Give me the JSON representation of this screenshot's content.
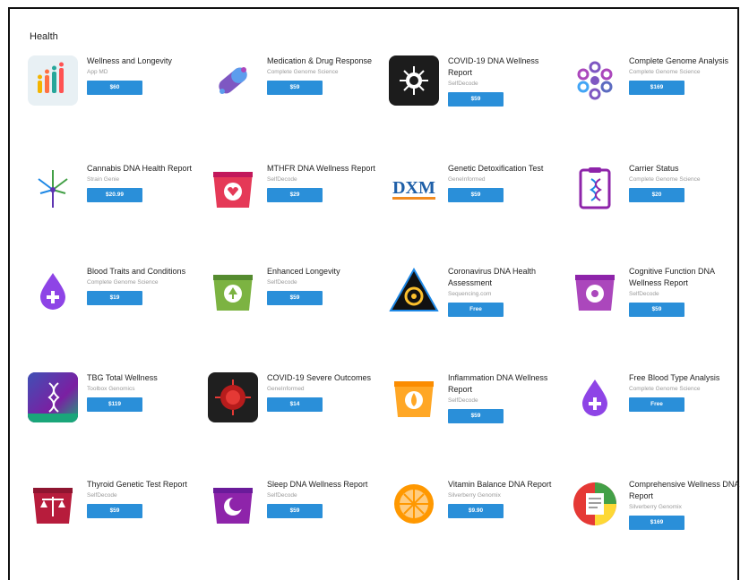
{
  "section": {
    "title": "Health"
  },
  "products": [
    {
      "name": "Wellness and Longevity",
      "vendor": "App MD",
      "price": "$60",
      "icon": "bar-chart-icon"
    },
    {
      "name": "Medication & Drug Response",
      "vendor": "Complete Genome Science",
      "price": "$59",
      "icon": "pill-icon"
    },
    {
      "name": "COVID-19 DNA Wellness Report",
      "vendor": "SelfDecode",
      "price": "$59",
      "icon": "virus-icon"
    },
    {
      "name": "Complete Genome Analysis",
      "vendor": "Complete Genome Science",
      "price": "$169",
      "icon": "genome-wheel-icon"
    },
    {
      "name": "Cannabis DNA Health Report",
      "vendor": "Strain Genie",
      "price": "$20.99",
      "icon": "cannabis-leaf-icon"
    },
    {
      "name": "MTHFR DNA Wellness Report",
      "vendor": "SelfDecode",
      "price": "$29",
      "icon": "pill-box-icon"
    },
    {
      "name": "Genetic Detoxification Test",
      "vendor": "GeneInformed",
      "price": "$59",
      "icon": "dxm-logo-icon"
    },
    {
      "name": "Carrier Status",
      "vendor": "Complete Genome Science",
      "price": "$20",
      "icon": "clipboard-dna-icon"
    },
    {
      "name": "Blood Traits and Conditions",
      "vendor": "Complete Genome Science",
      "price": "$19",
      "icon": "blood-drop-icon"
    },
    {
      "name": "Enhanced Longevity",
      "vendor": "SelfDecode",
      "price": "$59",
      "icon": "tree-icon"
    },
    {
      "name": "Coronavirus DNA Health Assessment",
      "vendor": "Sequencing.com",
      "price": "Free",
      "icon": "biohazard-icon"
    },
    {
      "name": "Cognitive Function DNA Wellness Report",
      "vendor": "SelfDecode",
      "price": "$59",
      "icon": "brain-gear-icon"
    },
    {
      "name": "TBG Total Wellness",
      "vendor": "Toolbox Genomics",
      "price": "$119",
      "icon": "tbg-logo-icon"
    },
    {
      "name": "COVID-19 Severe Outcomes",
      "vendor": "GeneInformed",
      "price": "$14",
      "icon": "virus-red-icon"
    },
    {
      "name": "Inflammation DNA Wellness Report",
      "vendor": "SelfDecode",
      "price": "$59",
      "icon": "flame-icon"
    },
    {
      "name": "Free Blood Type Analysis",
      "vendor": "Complete Genome Science",
      "price": "Free",
      "icon": "blood-drop-icon"
    },
    {
      "name": "Thyroid Genetic Test Report",
      "vendor": "SelfDecode",
      "price": "$59",
      "icon": "scales-icon"
    },
    {
      "name": "Sleep DNA Wellness Report",
      "vendor": "SelfDecode",
      "price": "$59",
      "icon": "moon-icon"
    },
    {
      "name": "Vitamin Balance DNA Report",
      "vendor": "Silverberry Genomix",
      "price": "$9.90",
      "icon": "orange-slice-icon"
    },
    {
      "name": "Comprehensive Wellness DNA Report",
      "vendor": "Silverberry Genomix",
      "price": "$169",
      "icon": "report-sheet-icon"
    }
  ]
}
